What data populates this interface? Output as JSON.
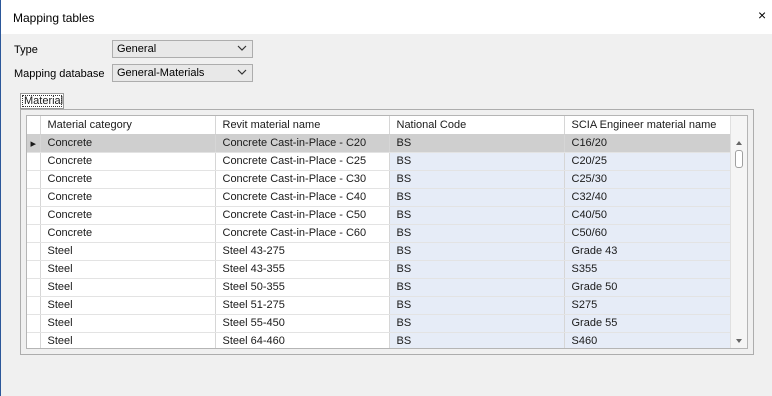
{
  "window": {
    "title": "Mapping tables",
    "close_glyph": "×"
  },
  "form": {
    "type_label": "Type",
    "type_value": "General",
    "db_label": "Mapping database",
    "db_value": "General-Materials"
  },
  "group": {
    "tab_label": "Material"
  },
  "grid": {
    "columns": [
      "Material category",
      "Revit material name",
      "National Code",
      "SCIA Engineer material name"
    ],
    "current_row_glyph": "▸",
    "rows": [
      [
        "Concrete",
        "Concrete Cast-in-Place - C20",
        "BS",
        "C16/20"
      ],
      [
        "Concrete",
        "Concrete Cast-in-Place - C25",
        "BS",
        "C20/25"
      ],
      [
        "Concrete",
        "Concrete Cast-in-Place - C30",
        "BS",
        "C25/30"
      ],
      [
        "Concrete",
        "Concrete Cast-in-Place - C40",
        "BS",
        "C32/40"
      ],
      [
        "Concrete",
        "Concrete Cast-in-Place - C50",
        "BS",
        "C40/50"
      ],
      [
        "Concrete",
        "Concrete Cast-in-Place - C60",
        "BS",
        "C50/60"
      ],
      [
        "Steel",
        "Steel 43-275",
        "BS",
        "Grade 43"
      ],
      [
        "Steel",
        "Steel 43-355",
        "BS",
        "S355"
      ],
      [
        "Steel",
        "Steel 50-355",
        "BS",
        "Grade 50"
      ],
      [
        "Steel",
        "Steel 51-275",
        "BS",
        "S275"
      ],
      [
        "Steel",
        "Steel 55-450",
        "BS",
        "Grade 55"
      ],
      [
        "Steel",
        "Steel 64-460",
        "BS",
        "S460"
      ]
    ]
  }
}
